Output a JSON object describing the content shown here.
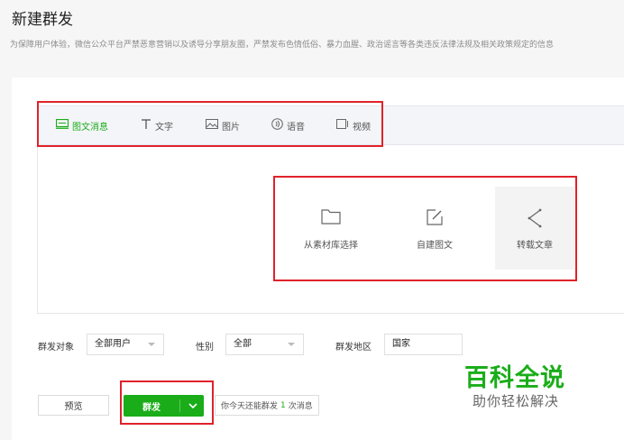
{
  "header": {
    "title": "新建群发",
    "notice": "为保障用户体验，微信公众平台严禁恶意营销以及诱导分享朋友圈，严禁发布色情低俗、暴力血腥、政治谣言等各类违反法律法规及相关政策规定的信息"
  },
  "tabs": [
    {
      "label": "图文消息",
      "icon": "article-icon",
      "active": true
    },
    {
      "label": "文字",
      "icon": "text-icon"
    },
    {
      "label": "图片",
      "icon": "image-icon"
    },
    {
      "label": "语音",
      "icon": "voice-icon"
    },
    {
      "label": "视频",
      "icon": "video-icon"
    }
  ],
  "choices": [
    {
      "label": "从素材库选择",
      "icon": "folder-icon"
    },
    {
      "label": "自建图文",
      "icon": "edit-icon"
    },
    {
      "label": "转载文章",
      "icon": "share-icon"
    }
  ],
  "form": {
    "target_label": "群发对象",
    "target_value": "全部用户",
    "gender_label": "性别",
    "gender_value": "全部",
    "region_label": "群发地区",
    "region_value": "国家"
  },
  "actions": {
    "preview_label": "预览",
    "send_label": "群发",
    "quota_prefix": "你今天还能群发",
    "quota_count": "1",
    "quota_suffix": "次消息"
  },
  "watermark": {
    "main": "百科全说",
    "sub": "助你轻松解决"
  },
  "colors": {
    "accent": "#1aad19",
    "highlight_box": "#e0222a"
  }
}
